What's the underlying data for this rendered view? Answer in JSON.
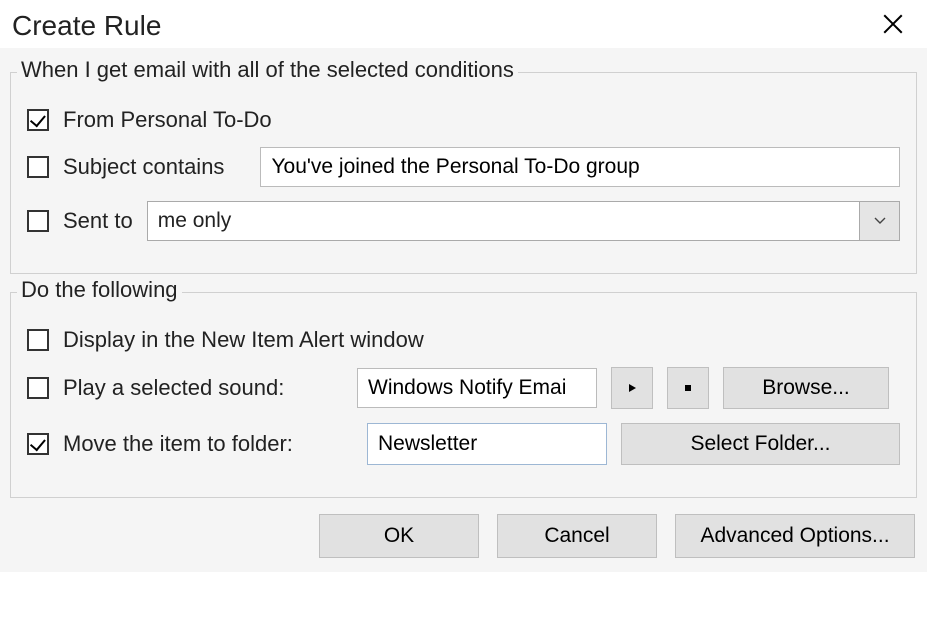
{
  "dialog": {
    "title": "Create Rule"
  },
  "conditions": {
    "legend": "When I get email with all of the selected conditions",
    "from": {
      "checked": true,
      "label": "From Personal To-Do"
    },
    "subject": {
      "checked": false,
      "label": "Subject contains",
      "value": "You've joined the Personal To-Do group"
    },
    "sentto": {
      "checked": false,
      "label": "Sent to",
      "value": "me only"
    }
  },
  "actions": {
    "legend": "Do the following",
    "display_alert": {
      "checked": false,
      "label": "Display in the New Item Alert window"
    },
    "play_sound": {
      "checked": false,
      "label": "Play a selected sound:",
      "value": "Windows Notify Emai",
      "browse_label": "Browse..."
    },
    "move_folder": {
      "checked": true,
      "label": "Move the item to folder:",
      "value": "Newsletter",
      "select_label": "Select Folder..."
    }
  },
  "footer": {
    "ok": "OK",
    "cancel": "Cancel",
    "advanced": "Advanced Options..."
  }
}
